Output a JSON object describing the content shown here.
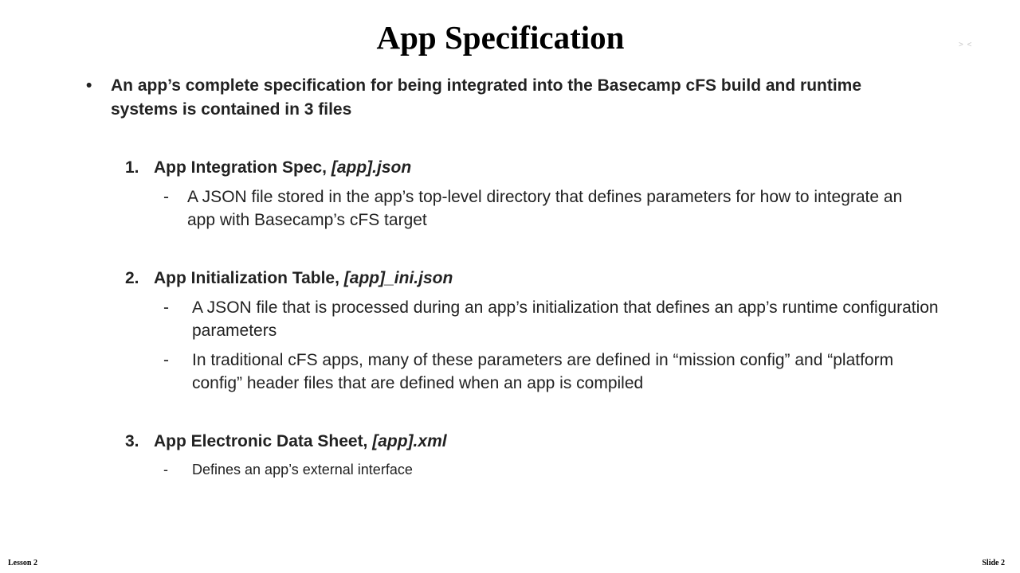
{
  "slide": {
    "title": "App Specification",
    "corner_mark": "> <",
    "intro": {
      "bullet": "•",
      "text": "An app’s complete specification for being integrated into the Basecamp cFS build and runtime systems is contained in 3 files"
    },
    "items": [
      {
        "number": "1.",
        "label": "App Integration Spec, ",
        "file": "[app].json",
        "subs": [
          {
            "dash": "-",
            "text": "A JSON file stored in the app’s top-level directory that defines parameters for how to integrate an app with Basecamp’s cFS target"
          }
        ]
      },
      {
        "number": "2.",
        "label": "App Initialization Table, ",
        "file": "[app]_ini.json",
        "subs": [
          {
            "dash": "-",
            "text": "A JSON file that is processed during an app’s initialization that defines an app’s runtime configuration parameters"
          },
          {
            "dash": "-",
            "text": "In traditional cFS apps, many of these parameters are defined in “mission config” and “platform config” header files that are defined when an app is compiled"
          }
        ]
      },
      {
        "number": "3.",
        "label": "App Electronic Data Sheet, ",
        "file": "[app].xml",
        "subs": [
          {
            "dash": "-",
            "text": "Defines an app’s external interface"
          }
        ]
      }
    ],
    "footer": {
      "lesson": "Lesson 2",
      "slide": "Slide 2"
    }
  }
}
